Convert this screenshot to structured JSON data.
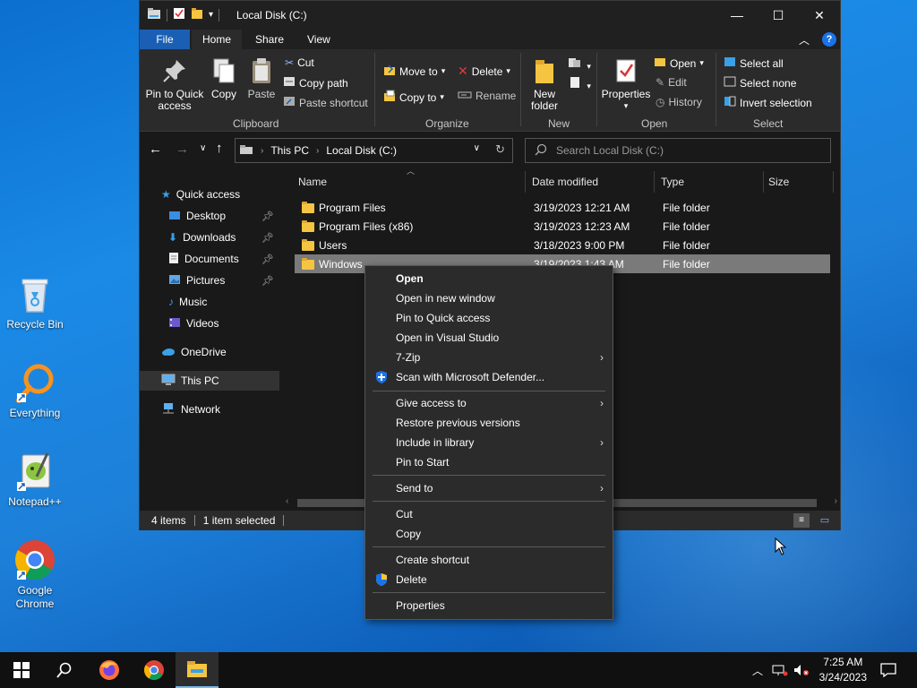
{
  "desktop": {
    "icons": [
      {
        "label": "Recycle Bin"
      },
      {
        "label": "Everything"
      },
      {
        "label": "Notepad++"
      },
      {
        "label": "Google Chrome"
      }
    ]
  },
  "window": {
    "title": "Local Disk (C:)",
    "controls": {
      "minimize": "—",
      "maximize": "☐",
      "close": "✕"
    }
  },
  "ribbon": {
    "tabs": {
      "file": "File",
      "home": "Home",
      "share": "Share",
      "view": "View"
    },
    "clipboard": {
      "pin": "Pin to Quick access",
      "copy": "Copy",
      "paste": "Paste",
      "cut": "Cut",
      "copy_path": "Copy path",
      "paste_shortcut": "Paste shortcut",
      "label": "Clipboard"
    },
    "organize": {
      "move_to": "Move to",
      "copy_to": "Copy to",
      "delete": "Delete",
      "rename": "Rename",
      "label": "Organize"
    },
    "new": {
      "new_folder": "New folder",
      "label": "New"
    },
    "open": {
      "properties": "Properties",
      "open": "Open",
      "edit": "Edit",
      "history": "History",
      "label": "Open"
    },
    "select": {
      "select_all": "Select all",
      "select_none": "Select none",
      "invert": "Invert selection",
      "label": "Select"
    }
  },
  "address": {
    "crumbs": [
      "This PC",
      "Local Disk (C:)"
    ],
    "search_placeholder": "Search Local Disk (C:)"
  },
  "nav_pane": {
    "quick_access": "Quick access",
    "items": [
      {
        "label": "Desktop",
        "pinned": true
      },
      {
        "label": "Downloads",
        "pinned": true
      },
      {
        "label": "Documents",
        "pinned": true
      },
      {
        "label": "Pictures",
        "pinned": true
      },
      {
        "label": "Music",
        "pinned": false
      },
      {
        "label": "Videos",
        "pinned": false
      }
    ],
    "onedrive": "OneDrive",
    "this_pc": "This PC",
    "network": "Network"
  },
  "file_list": {
    "columns": [
      "Name",
      "Date modified",
      "Type",
      "Size"
    ],
    "rows": [
      {
        "name": "Program Files",
        "date": "3/19/2023 12:21 AM",
        "type": "File folder",
        "size": ""
      },
      {
        "name": "Program Files (x86)",
        "date": "3/19/2023 12:23 AM",
        "type": "File folder",
        "size": ""
      },
      {
        "name": "Users",
        "date": "3/18/2023 9:00 PM",
        "type": "File folder",
        "size": ""
      },
      {
        "name": "Windows",
        "date": "3/19/2023 1:43 AM",
        "type": "File folder",
        "size": "",
        "selected": true
      }
    ]
  },
  "status": {
    "items": "4 items",
    "selected": "1 item selected"
  },
  "context_menu": {
    "items": [
      "Open",
      "Open in new window",
      "Pin to Quick access",
      "Open in Visual Studio",
      "7-Zip",
      "Scan with Microsoft Defender...",
      "Give access to",
      "Restore previous versions",
      "Include in library",
      "Pin to Start",
      "Send to",
      "Cut",
      "Copy",
      "Create shortcut",
      "Delete",
      "Properties"
    ]
  },
  "taskbar": {
    "time": "7:25 AM",
    "date": "3/24/2023"
  },
  "colors": {
    "accent": "#1a5fb4",
    "folder": "#f5c542",
    "window_bg": "#191919",
    "ribbon_bg": "#2b2b2b"
  }
}
